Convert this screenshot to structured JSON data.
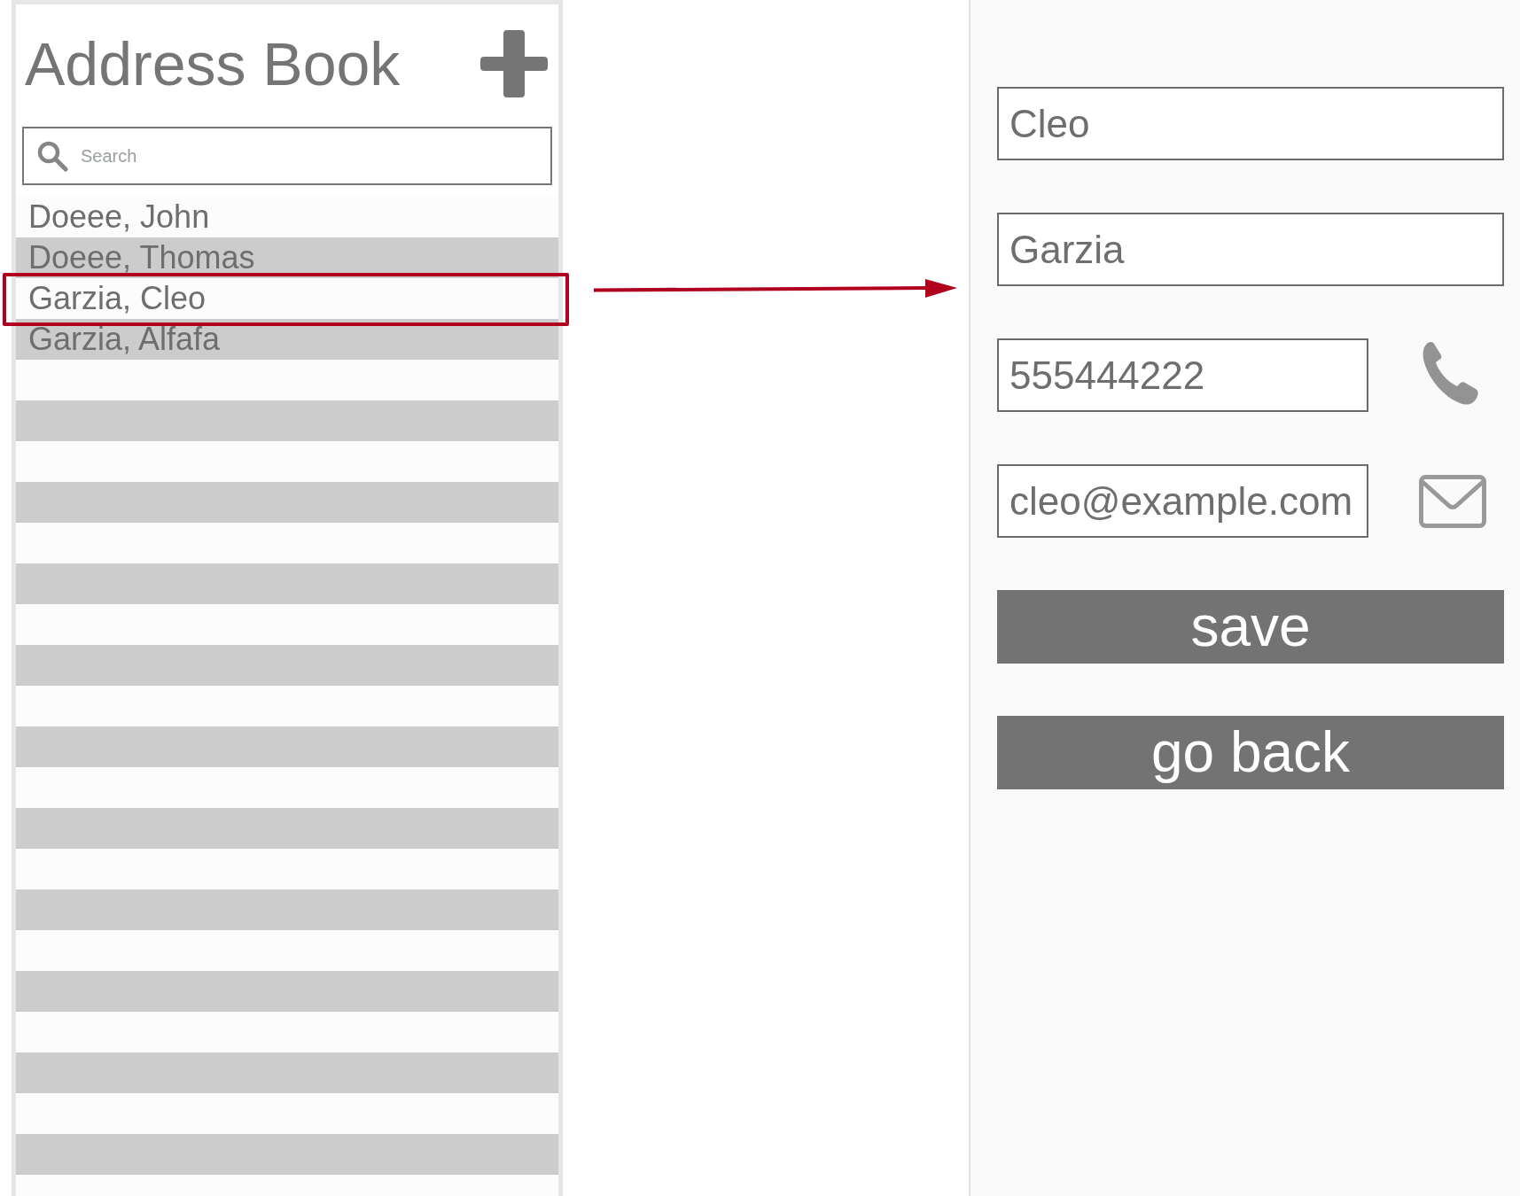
{
  "title": "Address Book",
  "search": {
    "placeholder": "Search"
  },
  "contacts": [
    {
      "name": "Doeee, John",
      "selected": false
    },
    {
      "name": "Doeee, Thomas",
      "selected": false
    },
    {
      "name": "Garzia, Cleo",
      "selected": true
    },
    {
      "name": "Garzia, Alfafa",
      "selected": false
    }
  ],
  "form": {
    "fields": [
      {
        "kind": "text",
        "value": "Cleo"
      },
      {
        "kind": "text",
        "value": "Garzia"
      },
      {
        "kind": "phone",
        "value": "555444222"
      },
      {
        "kind": "email",
        "value": "cleo@example.com"
      }
    ],
    "buttons": [
      "save",
      "go back"
    ]
  }
}
